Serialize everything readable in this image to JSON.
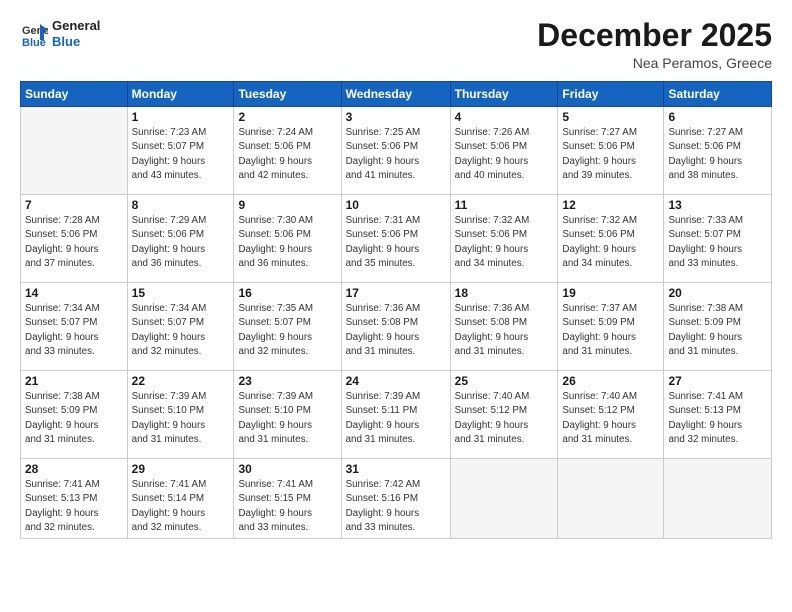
{
  "header": {
    "logo": {
      "line1": "General",
      "line2": "Blue"
    },
    "title": "December 2025",
    "subtitle": "Nea Peramos, Greece"
  },
  "weekdays": [
    "Sunday",
    "Monday",
    "Tuesday",
    "Wednesday",
    "Thursday",
    "Friday",
    "Saturday"
  ],
  "weeks": [
    [
      {
        "day": "",
        "info": ""
      },
      {
        "day": "1",
        "info": "Sunrise: 7:23 AM\nSunset: 5:07 PM\nDaylight: 9 hours\nand 43 minutes."
      },
      {
        "day": "2",
        "info": "Sunrise: 7:24 AM\nSunset: 5:06 PM\nDaylight: 9 hours\nand 42 minutes."
      },
      {
        "day": "3",
        "info": "Sunrise: 7:25 AM\nSunset: 5:06 PM\nDaylight: 9 hours\nand 41 minutes."
      },
      {
        "day": "4",
        "info": "Sunrise: 7:26 AM\nSunset: 5:06 PM\nDaylight: 9 hours\nand 40 minutes."
      },
      {
        "day": "5",
        "info": "Sunrise: 7:27 AM\nSunset: 5:06 PM\nDaylight: 9 hours\nand 39 minutes."
      },
      {
        "day": "6",
        "info": "Sunrise: 7:27 AM\nSunset: 5:06 PM\nDaylight: 9 hours\nand 38 minutes."
      }
    ],
    [
      {
        "day": "7",
        "info": "Sunrise: 7:28 AM\nSunset: 5:06 PM\nDaylight: 9 hours\nand 37 minutes."
      },
      {
        "day": "8",
        "info": "Sunrise: 7:29 AM\nSunset: 5:06 PM\nDaylight: 9 hours\nand 36 minutes."
      },
      {
        "day": "9",
        "info": "Sunrise: 7:30 AM\nSunset: 5:06 PM\nDaylight: 9 hours\nand 36 minutes."
      },
      {
        "day": "10",
        "info": "Sunrise: 7:31 AM\nSunset: 5:06 PM\nDaylight: 9 hours\nand 35 minutes."
      },
      {
        "day": "11",
        "info": "Sunrise: 7:32 AM\nSunset: 5:06 PM\nDaylight: 9 hours\nand 34 minutes."
      },
      {
        "day": "12",
        "info": "Sunrise: 7:32 AM\nSunset: 5:06 PM\nDaylight: 9 hours\nand 34 minutes."
      },
      {
        "day": "13",
        "info": "Sunrise: 7:33 AM\nSunset: 5:07 PM\nDaylight: 9 hours\nand 33 minutes."
      }
    ],
    [
      {
        "day": "14",
        "info": "Sunrise: 7:34 AM\nSunset: 5:07 PM\nDaylight: 9 hours\nand 33 minutes."
      },
      {
        "day": "15",
        "info": "Sunrise: 7:34 AM\nSunset: 5:07 PM\nDaylight: 9 hours\nand 32 minutes."
      },
      {
        "day": "16",
        "info": "Sunrise: 7:35 AM\nSunset: 5:07 PM\nDaylight: 9 hours\nand 32 minutes."
      },
      {
        "day": "17",
        "info": "Sunrise: 7:36 AM\nSunset: 5:08 PM\nDaylight: 9 hours\nand 31 minutes."
      },
      {
        "day": "18",
        "info": "Sunrise: 7:36 AM\nSunset: 5:08 PM\nDaylight: 9 hours\nand 31 minutes."
      },
      {
        "day": "19",
        "info": "Sunrise: 7:37 AM\nSunset: 5:09 PM\nDaylight: 9 hours\nand 31 minutes."
      },
      {
        "day": "20",
        "info": "Sunrise: 7:38 AM\nSunset: 5:09 PM\nDaylight: 9 hours\nand 31 minutes."
      }
    ],
    [
      {
        "day": "21",
        "info": "Sunrise: 7:38 AM\nSunset: 5:09 PM\nDaylight: 9 hours\nand 31 minutes."
      },
      {
        "day": "22",
        "info": "Sunrise: 7:39 AM\nSunset: 5:10 PM\nDaylight: 9 hours\nand 31 minutes."
      },
      {
        "day": "23",
        "info": "Sunrise: 7:39 AM\nSunset: 5:10 PM\nDaylight: 9 hours\nand 31 minutes."
      },
      {
        "day": "24",
        "info": "Sunrise: 7:39 AM\nSunset: 5:11 PM\nDaylight: 9 hours\nand 31 minutes."
      },
      {
        "day": "25",
        "info": "Sunrise: 7:40 AM\nSunset: 5:12 PM\nDaylight: 9 hours\nand 31 minutes."
      },
      {
        "day": "26",
        "info": "Sunrise: 7:40 AM\nSunset: 5:12 PM\nDaylight: 9 hours\nand 31 minutes."
      },
      {
        "day": "27",
        "info": "Sunrise: 7:41 AM\nSunset: 5:13 PM\nDaylight: 9 hours\nand 32 minutes."
      }
    ],
    [
      {
        "day": "28",
        "info": "Sunrise: 7:41 AM\nSunset: 5:13 PM\nDaylight: 9 hours\nand 32 minutes."
      },
      {
        "day": "29",
        "info": "Sunrise: 7:41 AM\nSunset: 5:14 PM\nDaylight: 9 hours\nand 32 minutes."
      },
      {
        "day": "30",
        "info": "Sunrise: 7:41 AM\nSunset: 5:15 PM\nDaylight: 9 hours\nand 33 minutes."
      },
      {
        "day": "31",
        "info": "Sunrise: 7:42 AM\nSunset: 5:16 PM\nDaylight: 9 hours\nand 33 minutes."
      },
      {
        "day": "",
        "info": ""
      },
      {
        "day": "",
        "info": ""
      },
      {
        "day": "",
        "info": ""
      }
    ]
  ]
}
